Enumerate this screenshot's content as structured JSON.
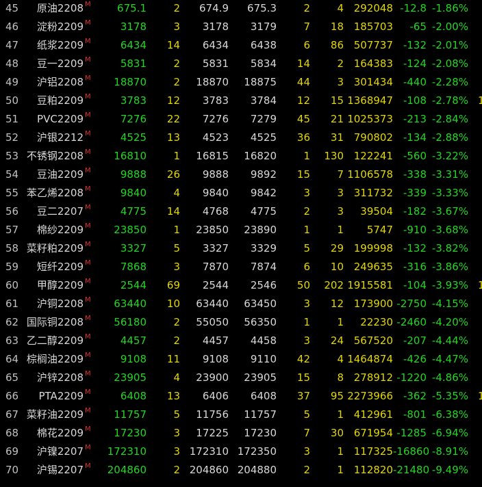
{
  "rows": [
    {
      "idx": "45",
      "name": "原油2208",
      "mark": "M",
      "last": "675.1",
      "lvol": "2",
      "bid": "674.9",
      "ask": "675.3",
      "bvol": "2",
      "avol": "4",
      "vol": "292048",
      "chg": "-12.8",
      "pct": "-1.86%",
      "edge": ""
    },
    {
      "idx": "46",
      "name": "淀粉2209",
      "mark": "M",
      "last": "3178",
      "lvol": "3",
      "bid": "3178",
      "ask": "3179",
      "bvol": "7",
      "avol": "18",
      "vol": "185703",
      "chg": "-65",
      "pct": "-2.00%",
      "edge": ""
    },
    {
      "idx": "47",
      "name": "纸浆2209",
      "mark": "M",
      "last": "6434",
      "lvol": "14",
      "bid": "6434",
      "ask": "6438",
      "bvol": "6",
      "avol": "86",
      "vol": "507737",
      "chg": "-132",
      "pct": "-2.01%",
      "edge": ""
    },
    {
      "idx": "48",
      "name": "豆一2209",
      "mark": "M",
      "last": "5831",
      "lvol": "2",
      "bid": "5831",
      "ask": "5834",
      "bvol": "14",
      "avol": "2",
      "vol": "164383",
      "chg": "-124",
      "pct": "-2.08%",
      "edge": ""
    },
    {
      "idx": "49",
      "name": "沪铝2208",
      "mark": "M",
      "last": "18870",
      "lvol": "2",
      "bid": "18870",
      "ask": "18875",
      "bvol": "44",
      "avol": "3",
      "vol": "301434",
      "chg": "-440",
      "pct": "-2.28%",
      "edge": ""
    },
    {
      "idx": "50",
      "name": "豆粕2209",
      "mark": "M",
      "last": "3783",
      "lvol": "12",
      "bid": "3783",
      "ask": "3784",
      "bvol": "12",
      "avol": "15",
      "vol": "1368947",
      "chg": "-108",
      "pct": "-2.78%",
      "edge": "1"
    },
    {
      "idx": "51",
      "name": "PVC2209",
      "mark": "M",
      "last": "7276",
      "lvol": "22",
      "bid": "7276",
      "ask": "7279",
      "bvol": "45",
      "avol": "21",
      "vol": "1025373",
      "chg": "-213",
      "pct": "-2.84%",
      "edge": ""
    },
    {
      "idx": "52",
      "name": "沪银2212",
      "mark": "M",
      "last": "4525",
      "lvol": "13",
      "bid": "4523",
      "ask": "4525",
      "bvol": "36",
      "avol": "31",
      "vol": "790802",
      "chg": "-134",
      "pct": "-2.88%",
      "edge": ""
    },
    {
      "idx": "53",
      "name": "不锈钢2208",
      "mark": "M",
      "last": "16810",
      "lvol": "1",
      "bid": "16815",
      "ask": "16820",
      "bvol": "1",
      "avol": "130",
      "vol": "122241",
      "chg": "-560",
      "pct": "-3.22%",
      "edge": ""
    },
    {
      "idx": "54",
      "name": "豆油2209",
      "mark": "M",
      "last": "9888",
      "lvol": "26",
      "bid": "9888",
      "ask": "9892",
      "bvol": "15",
      "avol": "7",
      "vol": "1106578",
      "chg": "-338",
      "pct": "-3.31%",
      "edge": ""
    },
    {
      "idx": "55",
      "name": "苯乙烯2208",
      "mark": "M",
      "last": "9840",
      "lvol": "4",
      "bid": "9840",
      "ask": "9842",
      "bvol": "3",
      "avol": "3",
      "vol": "311732",
      "chg": "-339",
      "pct": "-3.33%",
      "edge": ""
    },
    {
      "idx": "56",
      "name": "豆二2207",
      "mark": "M",
      "last": "4775",
      "lvol": "14",
      "bid": "4768",
      "ask": "4775",
      "bvol": "2",
      "avol": "3",
      "vol": "39504",
      "chg": "-182",
      "pct": "-3.67%",
      "edge": ""
    },
    {
      "idx": "57",
      "name": "棉纱2209",
      "mark": "M",
      "last": "23850",
      "lvol": "1",
      "bid": "23850",
      "ask": "23890",
      "bvol": "1",
      "avol": "1",
      "vol": "5747",
      "chg": "-910",
      "pct": "-3.68%",
      "edge": ""
    },
    {
      "idx": "58",
      "name": "菜籽粕2209",
      "mark": "M",
      "last": "3327",
      "lvol": "5",
      "bid": "3327",
      "ask": "3329",
      "bvol": "5",
      "avol": "29",
      "vol": "199998",
      "chg": "-132",
      "pct": "-3.82%",
      "edge": ""
    },
    {
      "idx": "59",
      "name": "短纤2209",
      "mark": "M",
      "last": "7868",
      "lvol": "3",
      "bid": "7870",
      "ask": "7874",
      "bvol": "6",
      "avol": "10",
      "vol": "249635",
      "chg": "-316",
      "pct": "-3.86%",
      "edge": ""
    },
    {
      "idx": "60",
      "name": "甲醇2209",
      "mark": "M",
      "last": "2544",
      "lvol": "69",
      "bid": "2544",
      "ask": "2546",
      "bvol": "50",
      "avol": "202",
      "vol": "1915581",
      "chg": "-104",
      "pct": "-3.93%",
      "edge": "1"
    },
    {
      "idx": "61",
      "name": "沪铜2208",
      "mark": "M",
      "last": "63440",
      "lvol": "10",
      "bid": "63440",
      "ask": "63450",
      "bvol": "3",
      "avol": "12",
      "vol": "173900",
      "chg": "-2750",
      "pct": "-4.15%",
      "edge": ""
    },
    {
      "idx": "62",
      "name": "国际铜2208",
      "mark": "M",
      "last": "56180",
      "lvol": "2",
      "bid": "55050",
      "ask": "56350",
      "bvol": "1",
      "avol": "1",
      "vol": "22230",
      "chg": "-2460",
      "pct": "-4.20%",
      "edge": ""
    },
    {
      "idx": "63",
      "name": "乙二醇2209",
      "mark": "M",
      "last": "4457",
      "lvol": "2",
      "bid": "4457",
      "ask": "4458",
      "bvol": "3",
      "avol": "24",
      "vol": "567520",
      "chg": "-207",
      "pct": "-4.44%",
      "edge": ""
    },
    {
      "idx": "64",
      "name": "棕榈油2209",
      "mark": "M",
      "last": "9108",
      "lvol": "11",
      "bid": "9108",
      "ask": "9110",
      "bvol": "42",
      "avol": "4",
      "vol": "1464874",
      "chg": "-426",
      "pct": "-4.47%",
      "edge": ""
    },
    {
      "idx": "65",
      "name": "沪锌2208",
      "mark": "M",
      "last": "23905",
      "lvol": "4",
      "bid": "23900",
      "ask": "23905",
      "bvol": "15",
      "avol": "8",
      "vol": "278912",
      "chg": "-1220",
      "pct": "-4.86%",
      "edge": ""
    },
    {
      "idx": "66",
      "name": "PTA2209",
      "mark": "M",
      "last": "6408",
      "lvol": "13",
      "bid": "6406",
      "ask": "6408",
      "bvol": "37",
      "avol": "95",
      "vol": "2273966",
      "chg": "-362",
      "pct": "-5.35%",
      "edge": "1"
    },
    {
      "idx": "67",
      "name": "菜籽油2209",
      "mark": "M",
      "last": "11757",
      "lvol": "5",
      "bid": "11756",
      "ask": "11757",
      "bvol": "5",
      "avol": "1",
      "vol": "412961",
      "chg": "-801",
      "pct": "-6.38%",
      "edge": ""
    },
    {
      "idx": "68",
      "name": "棉花2209",
      "mark": "M",
      "last": "17230",
      "lvol": "3",
      "bid": "17225",
      "ask": "17230",
      "bvol": "7",
      "avol": "30",
      "vol": "671954",
      "chg": "-1285",
      "pct": "-6.94%",
      "edge": ""
    },
    {
      "idx": "69",
      "name": "沪镍2207",
      "mark": "M",
      "last": "172310",
      "lvol": "3",
      "bid": "172310",
      "ask": "172350",
      "bvol": "3",
      "avol": "1",
      "vol": "117325",
      "chg": "-16860",
      "pct": "-8.91%",
      "edge": ""
    },
    {
      "idx": "70",
      "name": "沪锡2207",
      "mark": "M",
      "last": "204860",
      "lvol": "2",
      "bid": "204860",
      "ask": "204880",
      "bvol": "2",
      "avol": "1",
      "vol": "112820",
      "chg": "-21480",
      "pct": "-9.49%",
      "edge": ""
    }
  ]
}
